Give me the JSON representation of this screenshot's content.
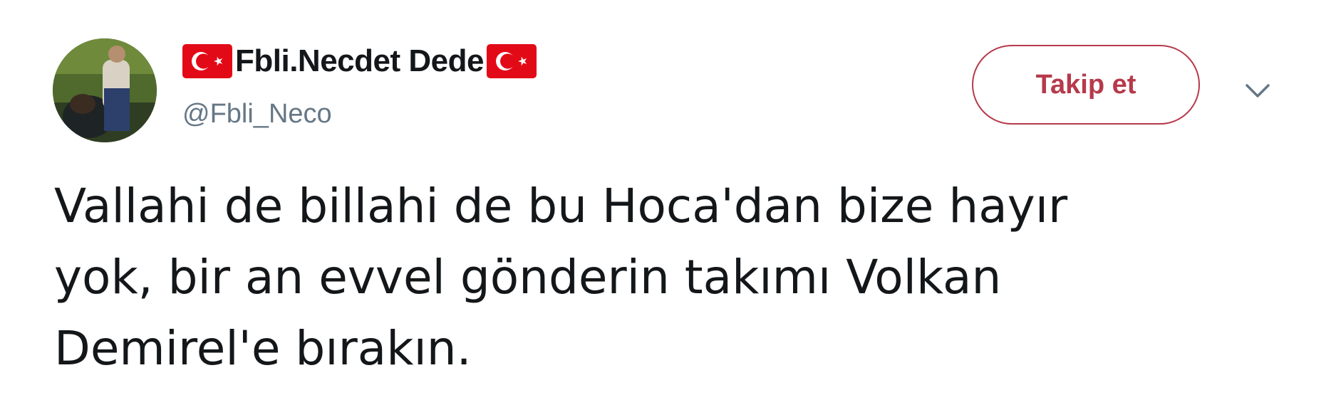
{
  "user": {
    "display_name": "Fbli.Necdet Dede",
    "handle": "@Fbli_Neco",
    "flag_icon": "turkey-flag-icon"
  },
  "actions": {
    "follow_label": "Takip et",
    "menu_icon": "chevron-down-icon"
  },
  "tweet": {
    "lines": [
      "Vallahi de billahi de bu Hoca'dan bize hayır",
      "yok, bir an evvel gönderin takımı Volkan",
      "Demirel'e bırakın."
    ]
  },
  "colors": {
    "accent": "#b63a4b",
    "text": "#14171a",
    "secondary_text": "#657786",
    "flag_red": "#e30a17"
  }
}
